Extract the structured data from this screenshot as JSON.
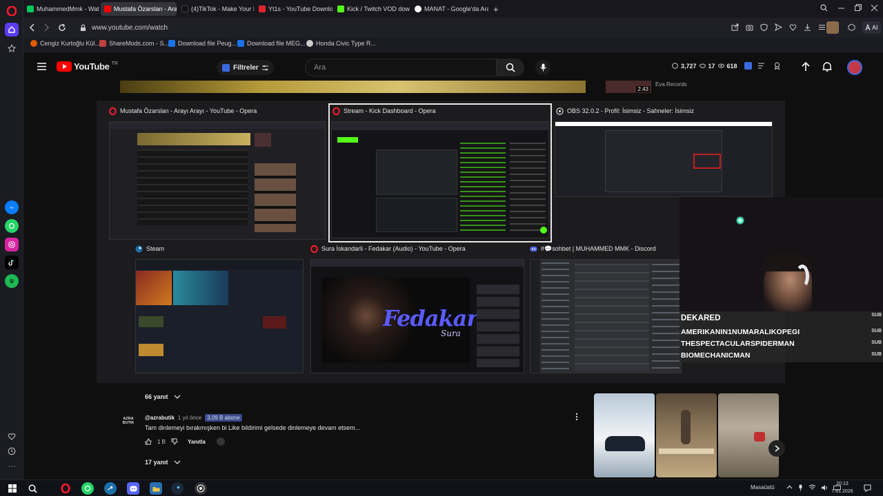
{
  "browser": {
    "tabs": [
      {
        "label": "MuhammedMmk - Watch",
        "color": "#00c85a"
      },
      {
        "label": "Mustafa Özarslan - Arayı",
        "color": "#ff0000"
      },
      {
        "label": "(4)TikTok - Make Your Day",
        "color": "#111111"
      },
      {
        "label": "Yt1s - YouTube Download",
        "color": "#e0252f"
      },
      {
        "label": "Kick / Twitch VOD downlo",
        "color": "#53fc18"
      },
      {
        "label": "MANAT - Google'da Ara",
        "color": "#ffffff"
      }
    ],
    "new_tab": "+",
    "url": "www.youtube.com/watch",
    "bookmarks": [
      {
        "label": "Cengiz Kurtoğlu Kül...",
        "color": "#e05a00"
      },
      {
        "label": "ShareMods.com - S...",
        "color": "#c04040"
      },
      {
        "label": "Download file Peug...",
        "color": "#1a73e8"
      },
      {
        "label": "Download file MEG...",
        "color": "#1a73e8"
      },
      {
        "label": "Honda Civic Type R...",
        "color": "#cccccc"
      }
    ],
    "ai_label": "AI"
  },
  "youtube": {
    "logo_text": "YouTube",
    "region": "TR",
    "filters_label": "Filtreler",
    "search_placeholder": "Ara",
    "stats": {
      "viewers": "3,727",
      "eye": "17",
      "views": "618"
    },
    "side_video": {
      "duration": "2:43",
      "channel": "Eva Records"
    },
    "comments": [
      {
        "replies": "66 yanıt"
      },
      {
        "author": "@azrabutik",
        "time": "1 yıl önce",
        "subs_badge": "3,09 B abone",
        "text": "Tam dinlemeyi bırakmışken bi Like  bildirimi gelsede dinlemeye devam etsem...",
        "likes": "1 B",
        "reply_label": "Yanıtla",
        "replies": "17 yanıt",
        "avatar_text": "AZRA\nBUTIK"
      }
    ]
  },
  "switcher": {
    "windows": [
      {
        "title": "Mustafa Özarslan - Arayı Arayı - YouTube - Opera",
        "icon_color": "#ff1b2d"
      },
      {
        "title": "Stream - Kick Dashboard - Opera",
        "icon_color": "#ff1b2d"
      },
      {
        "title": "OBS 32.0.2 - Profil: İsimsiz - Sahneler: İsimsiz",
        "icon_color": "#dddddd"
      },
      {
        "title": "Steam",
        "icon_color": "#1b6fa8"
      },
      {
        "title": "Sura İskandarli - Fedakar (Audio) - YouTube - Opera",
        "icon_color": "#ff1b2d"
      },
      {
        "title": "#💬sohbet | MUHAMMED MMK - Discord",
        "icon_color": "#5865f2"
      }
    ],
    "fedakar_text": "Fedakar",
    "sura_text": "Sura"
  },
  "stream_overlay": {
    "subs": [
      {
        "name": "DEKARED",
        "tag": "SUB"
      },
      {
        "name": "AMERIKANIN1NUMARALIKOPEGI",
        "tag": "SUB"
      },
      {
        "name": "THESPECTACULARSPIDERMAN",
        "tag": "SUB"
      },
      {
        "name": "BIOMECHANICMAN",
        "tag": "SUB"
      }
    ]
  },
  "taskbar": {
    "desktop_label": "Masaüstü",
    "time": "20:13",
    "date": "7.01.2026"
  }
}
